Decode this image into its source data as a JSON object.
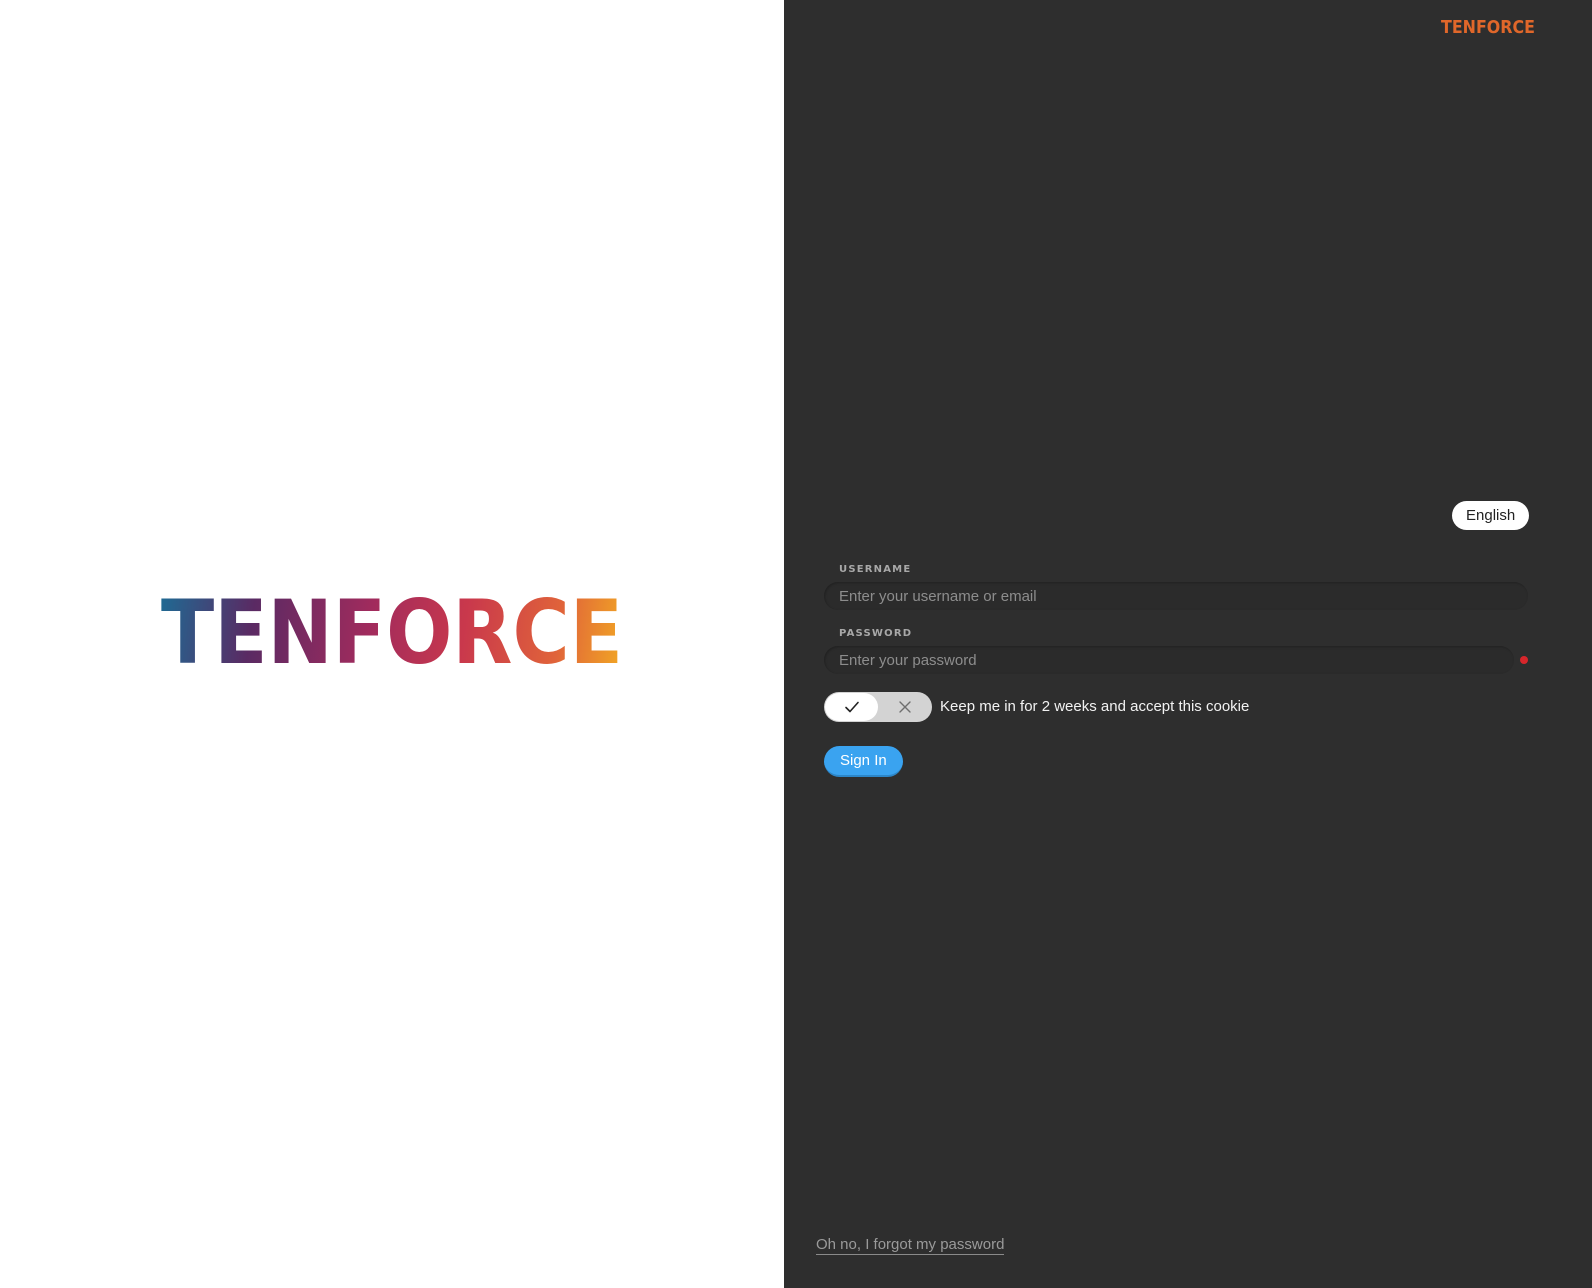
{
  "brand": {
    "wordmark": "TENFORCE",
    "gradient_colors": [
      "#1f6a93",
      "#5a2a63",
      "#a12b5d",
      "#c9384c",
      "#e0633a",
      "#f2a923"
    ],
    "corner_wordmark_color": "#e0672a"
  },
  "login": {
    "language_label": "English",
    "username": {
      "label": "USERNAME",
      "placeholder": "Enter your username or email",
      "value": ""
    },
    "password": {
      "label": "PASSWORD",
      "placeholder": "Enter your password",
      "value": "",
      "required_indicator_color": "#d7262b"
    },
    "remember": {
      "label": "Keep me in for 2 weeks and accept this cookie",
      "state": "on",
      "on_icon": "check-icon",
      "off_icon": "close-icon"
    },
    "signin_label": "Sign In",
    "forgot_label": "Oh no, I forgot my password"
  },
  "colors": {
    "panel_background": "#2e2e2e",
    "accent": "#3aa3f0"
  }
}
